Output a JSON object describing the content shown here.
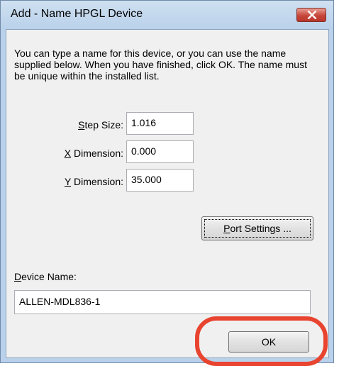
{
  "window": {
    "title": "Add - Name HPGL Device"
  },
  "dialog": {
    "description": "You can type a name for this device, or you can use the name supplied below. When you have finished, click OK. The name must be unique within the installed list.",
    "step_size": {
      "label_mnemonic": "S",
      "label_rest": "tep Size:",
      "value": "1.016"
    },
    "x_dimension": {
      "label_mnemonic": "X",
      "label_rest": " Dimension:",
      "value": "0.000"
    },
    "y_dimension": {
      "label_mnemonic": "Y",
      "label_rest": " Dimension:",
      "value": "35.000"
    },
    "port_settings": {
      "label_mnemonic": "P",
      "label_rest": "ort Settings ..."
    },
    "device_name": {
      "label_mnemonic": "D",
      "label_rest": "evice Name:",
      "value": "ALLEN-MDL836-1"
    },
    "ok_label": "OK"
  },
  "colors": {
    "highlight_ring": "#e8442f",
    "close_button": "#c7463a"
  }
}
